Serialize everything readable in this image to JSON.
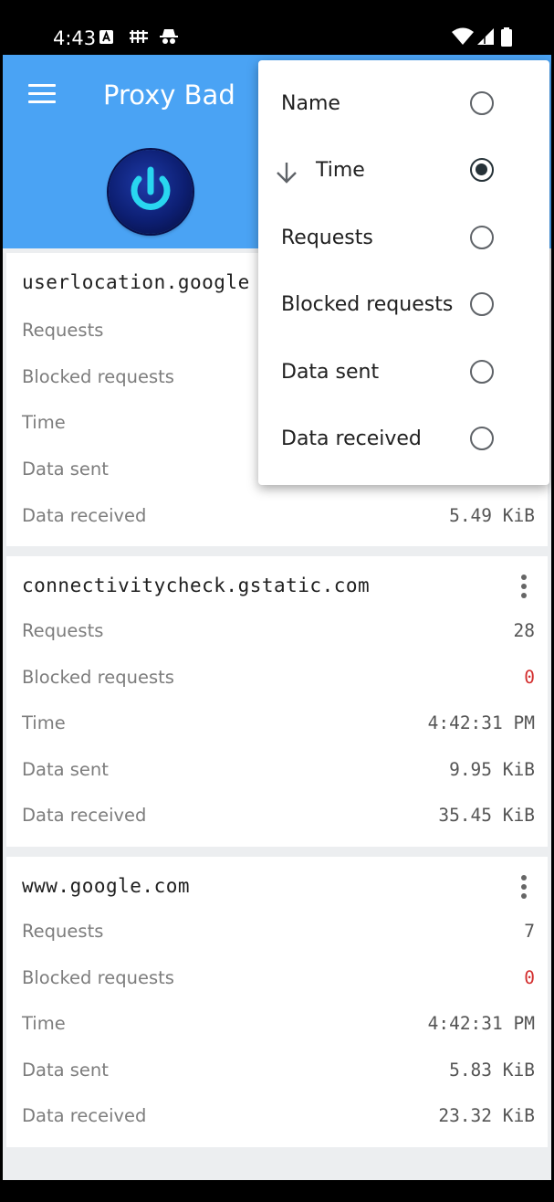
{
  "status_bar": {
    "time": "4:43",
    "icons": [
      "a-notification-icon",
      "vpn-key-icon",
      "incognito-icon",
      "wifi-icon",
      "signal-icon",
      "battery-icon"
    ]
  },
  "app_bar": {
    "title": "Proxy Bad",
    "menu_icon": "hamburger-icon",
    "power_icon": "power-icon",
    "color": "#4aa3f4"
  },
  "cards": [
    {
      "host": "userlocation.google",
      "rows": [
        {
          "label": "Requests",
          "value": ""
        },
        {
          "label": "Blocked requests",
          "value": ""
        },
        {
          "label": "Time",
          "value": ""
        },
        {
          "label": "Data sent",
          "value": ""
        },
        {
          "label": "Data received",
          "value": "5.49 KiB"
        }
      ]
    },
    {
      "host": "connectivitycheck.gstatic.com",
      "rows": [
        {
          "label": "Requests",
          "value": "28"
        },
        {
          "label": "Blocked requests",
          "value": "0"
        },
        {
          "label": "Time",
          "value": "4:42:31 PM"
        },
        {
          "label": "Data sent",
          "value": "9.95 KiB"
        },
        {
          "label": "Data received",
          "value": "35.45 KiB"
        }
      ]
    },
    {
      "host": "www.google.com",
      "rows": [
        {
          "label": "Requests",
          "value": "7"
        },
        {
          "label": "Blocked requests",
          "value": "0"
        },
        {
          "label": "Time",
          "value": "4:42:31 PM"
        },
        {
          "label": "Data sent",
          "value": "5.83 KiB"
        },
        {
          "label": "Data received",
          "value": "23.32 KiB"
        }
      ]
    }
  ],
  "sort_menu": {
    "items": [
      {
        "label": "Name",
        "selected": false
      },
      {
        "label": "Time",
        "selected": true,
        "direction_icon": "arrow-down-icon"
      },
      {
        "label": "Requests",
        "selected": false
      },
      {
        "label": "Blocked requests",
        "selected": false
      },
      {
        "label": "Data sent",
        "selected": false
      },
      {
        "label": "Data received",
        "selected": false
      }
    ]
  },
  "colors": {
    "blocked_value": "#d32f2f",
    "card_background": "#ffffff",
    "list_background": "#eceef0"
  }
}
